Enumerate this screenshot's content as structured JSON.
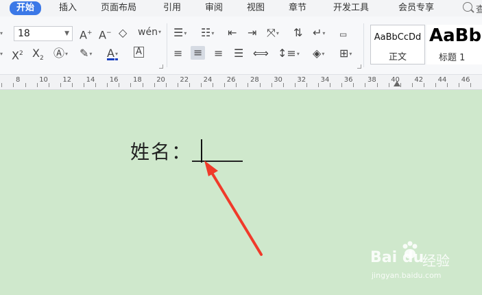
{
  "menu": {
    "items": [
      "开始",
      "插入",
      "页面布局",
      "引用",
      "审阅",
      "视图",
      "章节",
      "开发工具",
      "会员专享"
    ],
    "active_index": 0,
    "search_char": "查"
  },
  "ribbon": {
    "font_size": "18",
    "styles": [
      {
        "sample": "AaBbCcDd",
        "name": "正文"
      },
      {
        "sample": "AaBb",
        "name": "标题 1"
      }
    ],
    "icons": [
      "grow-font-icon",
      "shrink-font-icon",
      "clear-format-icon",
      "phonetic-guide-icon",
      "bullet-list-icon",
      "numbered-list-icon",
      "decrease-indent-icon",
      "increase-indent-icon",
      "chinese-layout-icon",
      "sort-icon",
      "line-break-icon",
      "ruler-toggle-icon",
      "superscript-icon",
      "subscript-icon",
      "text-effect-icon",
      "highlight-icon",
      "font-color-icon",
      "char-border-icon",
      "align-left-icon",
      "align-center-icon",
      "align-right-icon",
      "justify-icon",
      "distributed-icon",
      "line-spacing-icon",
      "shading-icon",
      "borders-icon"
    ],
    "font_color": "#1a3fbf"
  },
  "ruler": {
    "numbers": [
      "8",
      "10",
      "12",
      "14",
      "16",
      "18",
      "20",
      "22",
      "24",
      "26",
      "28",
      "30",
      "32",
      "34",
      "36",
      "38",
      "40",
      "42",
      "44",
      "46"
    ]
  },
  "document": {
    "field_label": "姓名：",
    "background": "#cfe8cc",
    "arrow_color": "#f03a2a"
  },
  "watermark": {
    "logo": "Bai du",
    "text": "经验",
    "url": "jingyan.baidu.com"
  }
}
